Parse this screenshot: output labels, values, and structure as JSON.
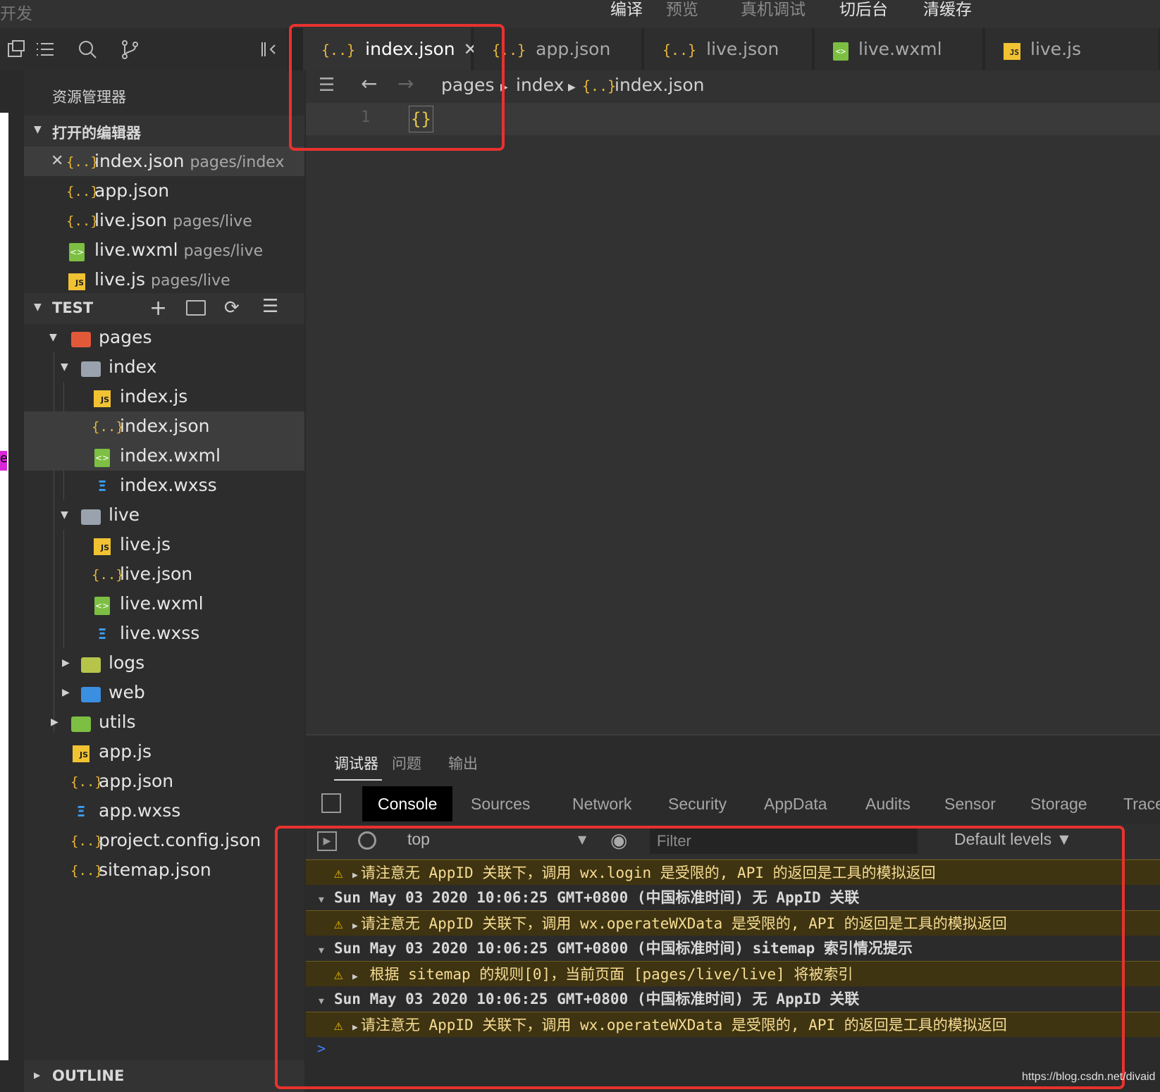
{
  "topbar": {
    "brand": "开发",
    "compile": "编译",
    "preview": "预览",
    "device_debug": "真机调试",
    "background": "切后台",
    "clear_cache": "清缓存"
  },
  "sidebar": {
    "title": "资源管理器",
    "open_editors": {
      "label": "打开的编辑器",
      "items": [
        {
          "name": "index.json",
          "path": "pages/index",
          "type": "json"
        },
        {
          "name": "app.json",
          "path": "",
          "type": "json"
        },
        {
          "name": "live.json",
          "path": "pages/live",
          "type": "json"
        },
        {
          "name": "live.wxml",
          "path": "pages/live",
          "type": "wxml"
        },
        {
          "name": "live.js",
          "path": "pages/live",
          "type": "js"
        }
      ]
    },
    "project": {
      "label": "TEST",
      "tree": [
        {
          "name": "pages",
          "type": "folder"
        },
        {
          "name": "index",
          "type": "folder"
        },
        {
          "name": "index.js",
          "type": "js"
        },
        {
          "name": "index.json",
          "type": "json"
        },
        {
          "name": "index.wxml",
          "type": "wxml"
        },
        {
          "name": "index.wxss",
          "type": "wxss"
        },
        {
          "name": "live",
          "type": "folder"
        },
        {
          "name": "live.js",
          "type": "js"
        },
        {
          "name": "live.json",
          "type": "json"
        },
        {
          "name": "live.wxml",
          "type": "wxml"
        },
        {
          "name": "live.wxss",
          "type": "wxss"
        },
        {
          "name": "logs",
          "type": "folder"
        },
        {
          "name": "web",
          "type": "folder"
        },
        {
          "name": "utils",
          "type": "folder"
        },
        {
          "name": "app.js",
          "type": "js"
        },
        {
          "name": "app.json",
          "type": "json"
        },
        {
          "name": "app.wxss",
          "type": "wxss"
        },
        {
          "name": "project.config.json",
          "type": "json"
        },
        {
          "name": "sitemap.json",
          "type": "json"
        }
      ]
    },
    "outline_label": "OUTLINE"
  },
  "tabs": [
    {
      "label": "index.json",
      "icon": "json-icon",
      "active": true
    },
    {
      "label": "app.json",
      "icon": "json-icon"
    },
    {
      "label": "live.json",
      "icon": "json-icon"
    },
    {
      "label": "live.wxml",
      "icon": "wxml-icon"
    },
    {
      "label": "live.js",
      "icon": "js-icon"
    }
  ],
  "editor": {
    "breadcrumb": [
      "pages",
      "index",
      "index.json"
    ],
    "line_number": "1",
    "code": "{}"
  },
  "debug": {
    "tabs": [
      "调试器",
      "问题",
      "输出"
    ],
    "devtools_tabs": [
      "Console",
      "Sources",
      "Network",
      "Security",
      "AppData",
      "Audits",
      "Sensor",
      "Storage",
      "Trace"
    ],
    "context": "top",
    "filter_placeholder": "Filter",
    "levels": "Default levels",
    "logs": [
      {
        "kind": "warn",
        "text": "请注意无 AppID 关联下，调用 wx.login 是受限的, API 的返回是工具的模拟返回"
      },
      {
        "kind": "group",
        "text": "Sun May 03 2020 10:06:25 GMT+0800 (中国标准时间) 无 AppID 关联"
      },
      {
        "kind": "warn",
        "text": "请注意无 AppID 关联下，调用 wx.operateWXData 是受限的, API 的返回是工具的模拟返回"
      },
      {
        "kind": "group",
        "text": "Sun May 03 2020 10:06:25 GMT+0800 (中国标准时间) sitemap 索引情况提示"
      },
      {
        "kind": "warn",
        "text": " 根据 sitemap 的规则[0]，当前页面 [pages/live/live] 将被索引"
      },
      {
        "kind": "group",
        "text": "Sun May 03 2020 10:06:25 GMT+0800 (中国标准时间) 无 AppID 关联"
      },
      {
        "kind": "warn",
        "text": "请注意无 AppID 关联下，调用 wx.operateWXData 是受限的, API 的返回是工具的模拟返回"
      }
    ],
    "prompt": ">"
  },
  "watermark": "https://blog.csdn.net/divaid",
  "colors": {
    "warning_bg": "#3f3411",
    "annotation_red": "#e8322e",
    "json_icon": "#e8b739"
  }
}
